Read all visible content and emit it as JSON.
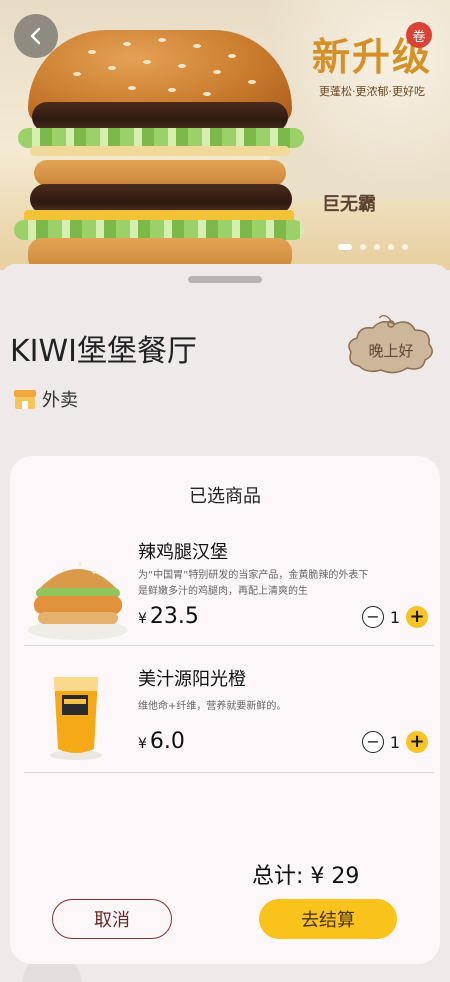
{
  "banner": {
    "promo_title": "新升级",
    "promo_subtitle": "更蓬松·更浓郁·更好吃",
    "coupon_badge": "卷",
    "product_name": "巨无霸"
  },
  "store": {
    "name": "KIWI堡堡餐厅",
    "delivery_label": "外卖",
    "greeting": "晚上好"
  },
  "modal": {
    "title": "已选商品",
    "items": [
      {
        "name": "辣鸡腿汉堡",
        "description": "为“中国胃”特别研发的当家产品，金黄脆辣的外表下是鲜嫩多汁的鸡腿肉，再配上清爽的生",
        "currency": "¥",
        "price": "23.5",
        "quantity": "1"
      },
      {
        "name": "美汁源阳光橙",
        "description": "维他命+纤维，营养就要新鲜的。",
        "currency": "¥",
        "price": "6.0",
        "quantity": "1"
      }
    ],
    "total_label": "总计: ¥  29",
    "cancel_label": "取消",
    "checkout_label": "去结算"
  },
  "colors": {
    "accent": "#f9c31c",
    "cancel_border": "#7a3232",
    "modal_bg": "#fdf7fa",
    "page_bg": "#efe9ea"
  },
  "icons": {
    "back": "chevron-left-icon",
    "delivery": "store-icon",
    "minus": "minus-icon",
    "plus": "plus-icon"
  }
}
